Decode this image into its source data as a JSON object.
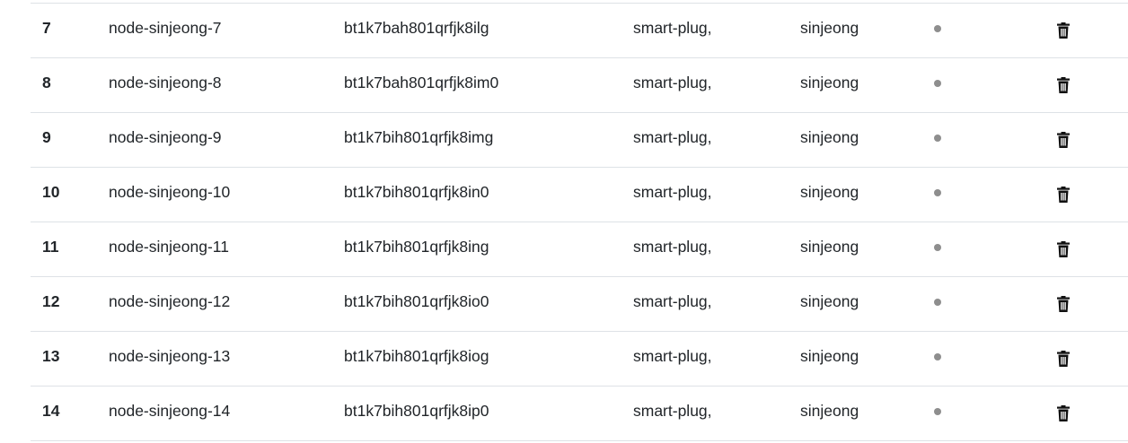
{
  "table": {
    "rows": [
      {
        "num": "7",
        "name": "node-sinjeong-7",
        "id": "bt1k7bah801qrfjk8ilg",
        "type": "smart-plug,",
        "owner": "sinjeong"
      },
      {
        "num": "8",
        "name": "node-sinjeong-8",
        "id": "bt1k7bah801qrfjk8im0",
        "type": "smart-plug,",
        "owner": "sinjeong"
      },
      {
        "num": "9",
        "name": "node-sinjeong-9",
        "id": "bt1k7bih801qrfjk8img",
        "type": "smart-plug,",
        "owner": "sinjeong"
      },
      {
        "num": "10",
        "name": "node-sinjeong-10",
        "id": "bt1k7bih801qrfjk8in0",
        "type": "smart-plug,",
        "owner": "sinjeong"
      },
      {
        "num": "11",
        "name": "node-sinjeong-11",
        "id": "bt1k7bih801qrfjk8ing",
        "type": "smart-plug,",
        "owner": "sinjeong"
      },
      {
        "num": "12",
        "name": "node-sinjeong-12",
        "id": "bt1k7bih801qrfjk8io0",
        "type": "smart-plug,",
        "owner": "sinjeong"
      },
      {
        "num": "13",
        "name": "node-sinjeong-13",
        "id": "bt1k7bih801qrfjk8iog",
        "type": "smart-plug,",
        "owner": "sinjeong"
      },
      {
        "num": "14",
        "name": "node-sinjeong-14",
        "id": "bt1k7bih801qrfjk8ip0",
        "type": "smart-plug,",
        "owner": "sinjeong"
      }
    ],
    "status_icon": "status-dot-icon",
    "status_color": "#8e8e8e",
    "delete_icon": "trash-icon"
  }
}
